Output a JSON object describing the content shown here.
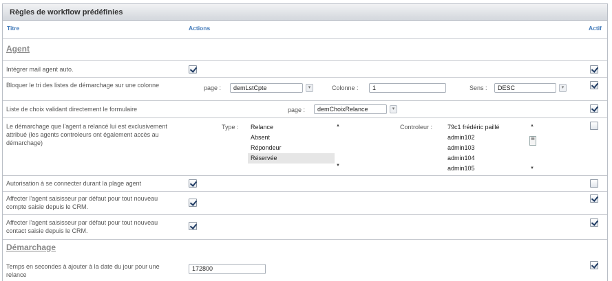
{
  "panel": {
    "title": "Règles de workflow prédéfinies"
  },
  "columns": {
    "titre": "Titre",
    "actions": "Actions",
    "actif": "Actif"
  },
  "sections": {
    "agent": "Agent",
    "demarchage": "Démarchage"
  },
  "rows": {
    "mail_auto": {
      "label": "Intégrer mail agent auto.",
      "action_checked": true,
      "actif": true
    },
    "bloquer_tri": {
      "label": "Bloquer le tri des listes de démarchage sur une colonne",
      "page_label": "page :",
      "page_value": "demLstCpte",
      "colonne_label": "Colonne :",
      "colonne_value": "1",
      "sens_label": "Sens :",
      "sens_value": "DESC",
      "actif": true
    },
    "liste_choix": {
      "label": "Liste de choix validant directement le formulaire",
      "page_label": "page :",
      "page_value": "demChoixRelance",
      "actif": true
    },
    "demarchage_relance": {
      "label": "Le démarchage que l'agent a relancé lui est exclusivement attribué (les agents controleurs ont également accès au démarchage)",
      "type_label": "Type :",
      "type_options": [
        "Relance",
        "Absent",
        "Répondeur",
        "Réservée"
      ],
      "type_selected": "Réservée",
      "controleur_label": "Controleur :",
      "controleur_options": [
        "79c1 frédéric paillé",
        "admin102",
        "admin103",
        "admin104",
        "admin105"
      ],
      "actif": false
    },
    "autorisation": {
      "label": "Autorisation à se connecter durant la plage agent",
      "action_checked": true,
      "actif": false
    },
    "affecter_compte": {
      "label": "Affecter l'agent saisisseur par défaut pour tout nouveau compte saisie depuis le CRM.",
      "action_checked": true,
      "actif": true
    },
    "affecter_contact": {
      "label": "Affecter l'agent saisisseur par défaut pour tout nouveau contact saisie depuis le CRM.",
      "action_checked": true,
      "actif": true
    },
    "temps_secondes": {
      "label": "Temps en secondes à ajouter à la date du jour pour une relance",
      "value": "172800",
      "actif": true
    }
  }
}
